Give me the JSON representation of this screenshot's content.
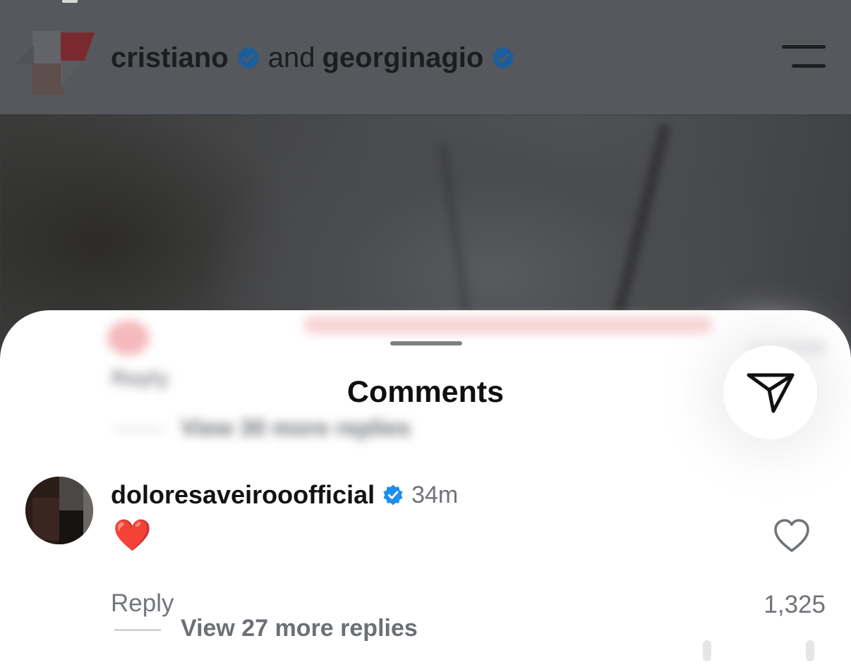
{
  "post_header": {
    "user_one": "cristiano",
    "connector": "and",
    "user_two": "georginagio",
    "verified_color": "#1877d2"
  },
  "sheet": {
    "title": "Comments",
    "obscured_comment": {
      "reply_label": "Reply",
      "replies_label": "View 30 more replies"
    }
  },
  "comment": {
    "username": "doloresaveirooofficial",
    "time": "34m",
    "text": "❤️",
    "reply_label": "Reply",
    "like_count": "1,325",
    "view_replies": "View 27 more replies",
    "verified_color": "#1f8cf0"
  },
  "colors": {
    "accent_verified": "#1877d2",
    "like_heart": "#e0212d",
    "secondary_text": "#6f7378"
  }
}
